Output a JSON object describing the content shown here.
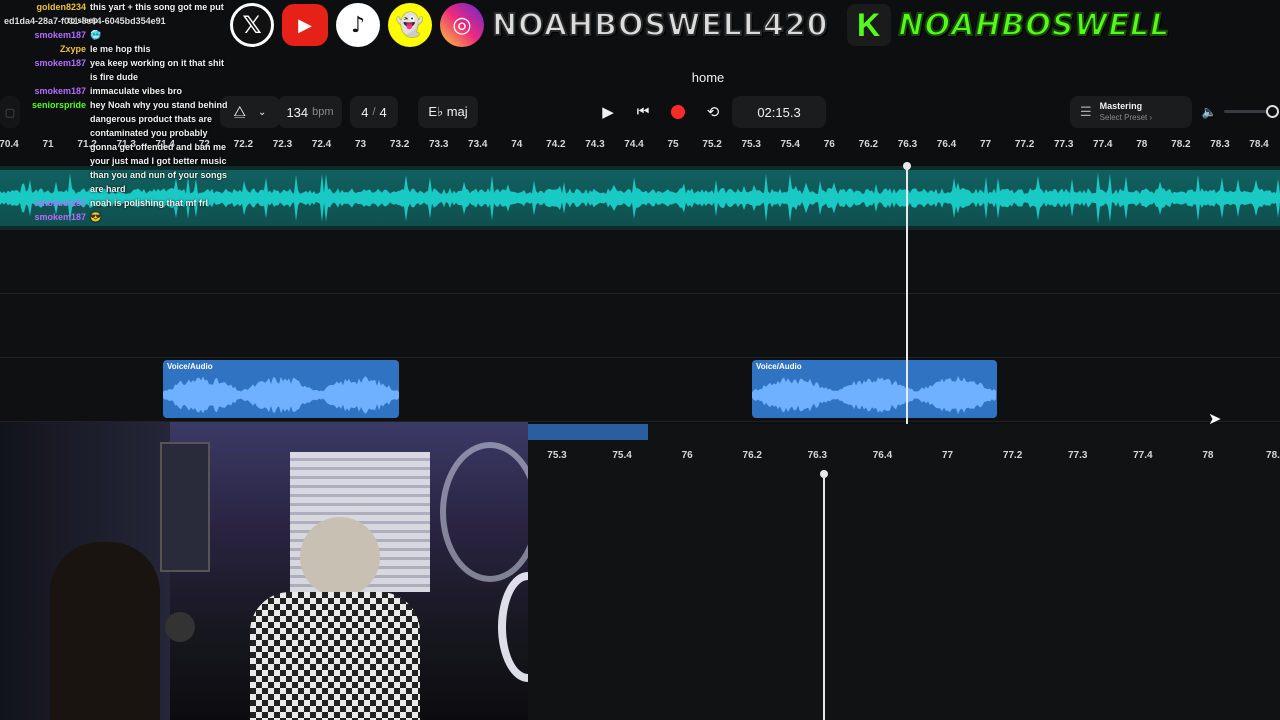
{
  "chat": [
    {
      "user": "golden8234",
      "color": "#f0c040",
      "msg": "this yart + this song got me put"
    },
    {
      "user": "",
      "color": "#ffffff",
      "msg": "to sleep",
      "hash": "ed1da4-28a7-f011-8e64-6045bd354e91"
    },
    {
      "user": "smokem187",
      "color": "#b46cff",
      "msg": "🥶"
    },
    {
      "user": "Zxype",
      "color": "#f0c040",
      "msg": "le me hop this"
    },
    {
      "user": "smokem187",
      "color": "#b46cff",
      "msg": "yea keep working on it that shit is fire dude"
    },
    {
      "user": "smokem187",
      "color": "#b46cff",
      "msg": "immaculate vibes bro"
    },
    {
      "user": "seniorspride",
      "color": "#53fc18",
      "msg": "hey Noah why you stand behind dangerous product thats are contaminated you probably gonna get offended and ban me your just mad I got better music than you and nun of your songs are hard"
    },
    {
      "user": "smokem187",
      "color": "#b46cff",
      "msg": "noah is polishing that mf frl"
    },
    {
      "user": "smokem187",
      "color": "#b46cff",
      "msg": "😎"
    }
  ],
  "social": {
    "x_icon": "x-logo-icon",
    "youtube_icon": "youtube-icon",
    "tiktok_icon": "tiktok-icon",
    "snapchat_icon": "snapchat-icon",
    "instagram_icon": "instagram-icon",
    "handle": "NOAHBOSWELL420",
    "kick_letter": "K",
    "kick_handle": "NOAHBOSWELL"
  },
  "daw": {
    "title": "home",
    "bpm": "134",
    "bpm_unit": "bpm",
    "time_sig_top": "4",
    "time_sig_sep": "/",
    "time_sig_bottom": "4",
    "key": "E♭ maj",
    "time": "02:15.3",
    "mastering_title": "Mastering",
    "mastering_preset": "Select Preset ›",
    "colors": {
      "track_teal": "#19c9c4",
      "clip_blue": "#2f73c2",
      "record": "#ff2a2a"
    }
  },
  "ruler": [
    "70.4",
    "71",
    "71.2",
    "71.3",
    "71.4",
    "72",
    "72.2",
    "72.3",
    "72.4",
    "73",
    "73.2",
    "73.3",
    "73.4",
    "74",
    "74.2",
    "74.3",
    "74.4",
    "75",
    "75.2",
    "75.3",
    "75.4",
    "76",
    "76.2",
    "76.3",
    "76.4",
    "77",
    "77.2",
    "77.3",
    "77.4",
    "78",
    "78.2",
    "78.3",
    "78.4"
  ],
  "clips": [
    {
      "label": "Voice/Audio"
    },
    {
      "label": "Voice/Audio"
    }
  ],
  "lower_ruler": [
    "75.3",
    "75.4",
    "76",
    "76.2",
    "76.3",
    "76.4",
    "77",
    "77.2",
    "77.3",
    "77.4",
    "78",
    "78."
  ]
}
